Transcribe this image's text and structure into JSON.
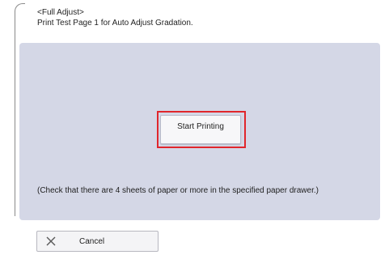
{
  "header": {
    "title": "<Full Adjust>",
    "instruction": "Print Test Page 1 for Auto Adjust Gradation."
  },
  "panel": {
    "start_button_label": "Start Printing",
    "note": "(Check that there are 4 sheets of paper or more in the specified paper drawer.)"
  },
  "footer": {
    "cancel_label": "Cancel"
  },
  "icons": {
    "cancel": "close-icon"
  },
  "colors": {
    "panel_bg": "#d4d7e6",
    "highlight": "#e0262c",
    "button_bg": "#f7f7f9"
  }
}
